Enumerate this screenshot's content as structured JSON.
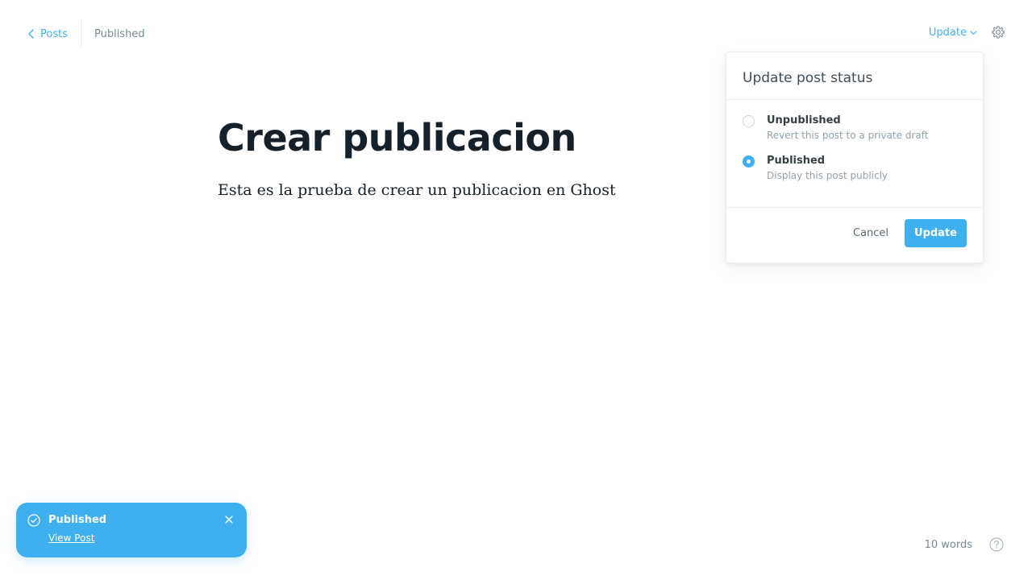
{
  "header": {
    "back_label": "Posts",
    "status": "Published",
    "update_label": "Update"
  },
  "editor": {
    "title": "Crear publicacion",
    "body": "Esta es la prueba de crear un publicacion en Ghost"
  },
  "popover": {
    "title": "Update post status",
    "options": [
      {
        "label": "Unpublished",
        "description": "Revert this post to a private draft",
        "checked": false
      },
      {
        "label": "Published",
        "description": "Display this post publicly",
        "checked": true
      }
    ],
    "cancel_label": "Cancel",
    "update_label": "Update"
  },
  "toast": {
    "title": "Published",
    "link": "View Post"
  },
  "footer": {
    "word_count": "10 words"
  },
  "colors": {
    "accent": "#3eb0ef",
    "text": "#15212a",
    "muted": "#738a94"
  },
  "icons": [
    "chevron-left-icon",
    "chevron-down-icon",
    "gear-icon",
    "check-circle-icon",
    "close-icon",
    "help-icon"
  ]
}
